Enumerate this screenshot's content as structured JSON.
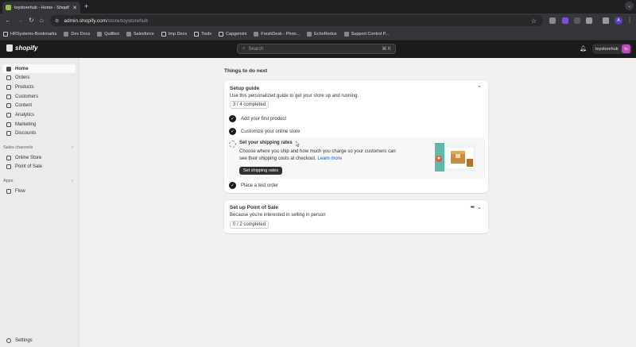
{
  "browser": {
    "tab_title": "toystorehub - Home - Shopify",
    "url_host": "admin.shopify.com",
    "url_path": "/store/toystorehub",
    "profile_initial": "A",
    "bookmarks": [
      {
        "label": "HRSystems-Bookmarks",
        "icon": "folder-icon"
      },
      {
        "label": "Dev Docs",
        "icon": "bookmark-icon"
      },
      {
        "label": "Quillbot",
        "icon": "quillbot-icon"
      },
      {
        "label": "Salesforce",
        "icon": "salesforce-icon"
      },
      {
        "label": "Imp Docs",
        "icon": "folder-icon"
      },
      {
        "label": "Tools",
        "icon": "folder-icon"
      },
      {
        "label": "Capgemini",
        "icon": "folder-icon"
      },
      {
        "label": "FreshDesk - Phon...",
        "icon": "freshdesk-icon"
      },
      {
        "label": "EchoRedux",
        "icon": "bookmark-icon"
      },
      {
        "label": "Support Control P...",
        "icon": "bookmark-icon"
      }
    ]
  },
  "topbar": {
    "brand": "shopify",
    "search_placeholder": "Search",
    "search_shortcut": "⌘ K",
    "store_name": "toystorehub",
    "store_avatar": "To"
  },
  "sidebar": {
    "items": [
      {
        "label": "Home",
        "icon": "home-icon",
        "active": true
      },
      {
        "label": "Orders",
        "icon": "orders-icon"
      },
      {
        "label": "Products",
        "icon": "products-icon"
      },
      {
        "label": "Customers",
        "icon": "customers-icon"
      },
      {
        "label": "Content",
        "icon": "content-icon"
      },
      {
        "label": "Analytics",
        "icon": "analytics-icon"
      },
      {
        "label": "Marketing",
        "icon": "marketing-icon"
      },
      {
        "label": "Discounts",
        "icon": "discounts-icon"
      }
    ],
    "sales_channels_label": "Sales channels",
    "sales_channels": [
      {
        "label": "Online Store",
        "icon": "online-store-icon"
      },
      {
        "label": "Point of Sale",
        "icon": "pos-icon"
      }
    ],
    "apps_label": "Apps",
    "apps": [
      {
        "label": "Flow",
        "icon": "flow-icon"
      }
    ],
    "settings_label": "Settings"
  },
  "main": {
    "heading": "Things to do next",
    "setup_guide": {
      "title": "Setup guide",
      "subtitle": "Use this personalized guide to get your store up and running.",
      "progress": "3 / 4 completed",
      "tasks": [
        {
          "label": "Add your first product",
          "done": true
        },
        {
          "label": "Customize your online store",
          "done": true
        },
        {
          "label": "Set your shipping rates",
          "done": false
        },
        {
          "label": "Place a test order",
          "done": true
        }
      ],
      "shipping_desc": "Choose where you ship and how much you charge so your customers can see their shipping costs at checkout.",
      "learn_more": "Learn more",
      "shipping_button": "Set shipping rates"
    },
    "pos": {
      "title": "Set up Point of Sale",
      "subtitle": "Because you're interested in selling in person",
      "progress": "0 / 2 completed"
    }
  }
}
